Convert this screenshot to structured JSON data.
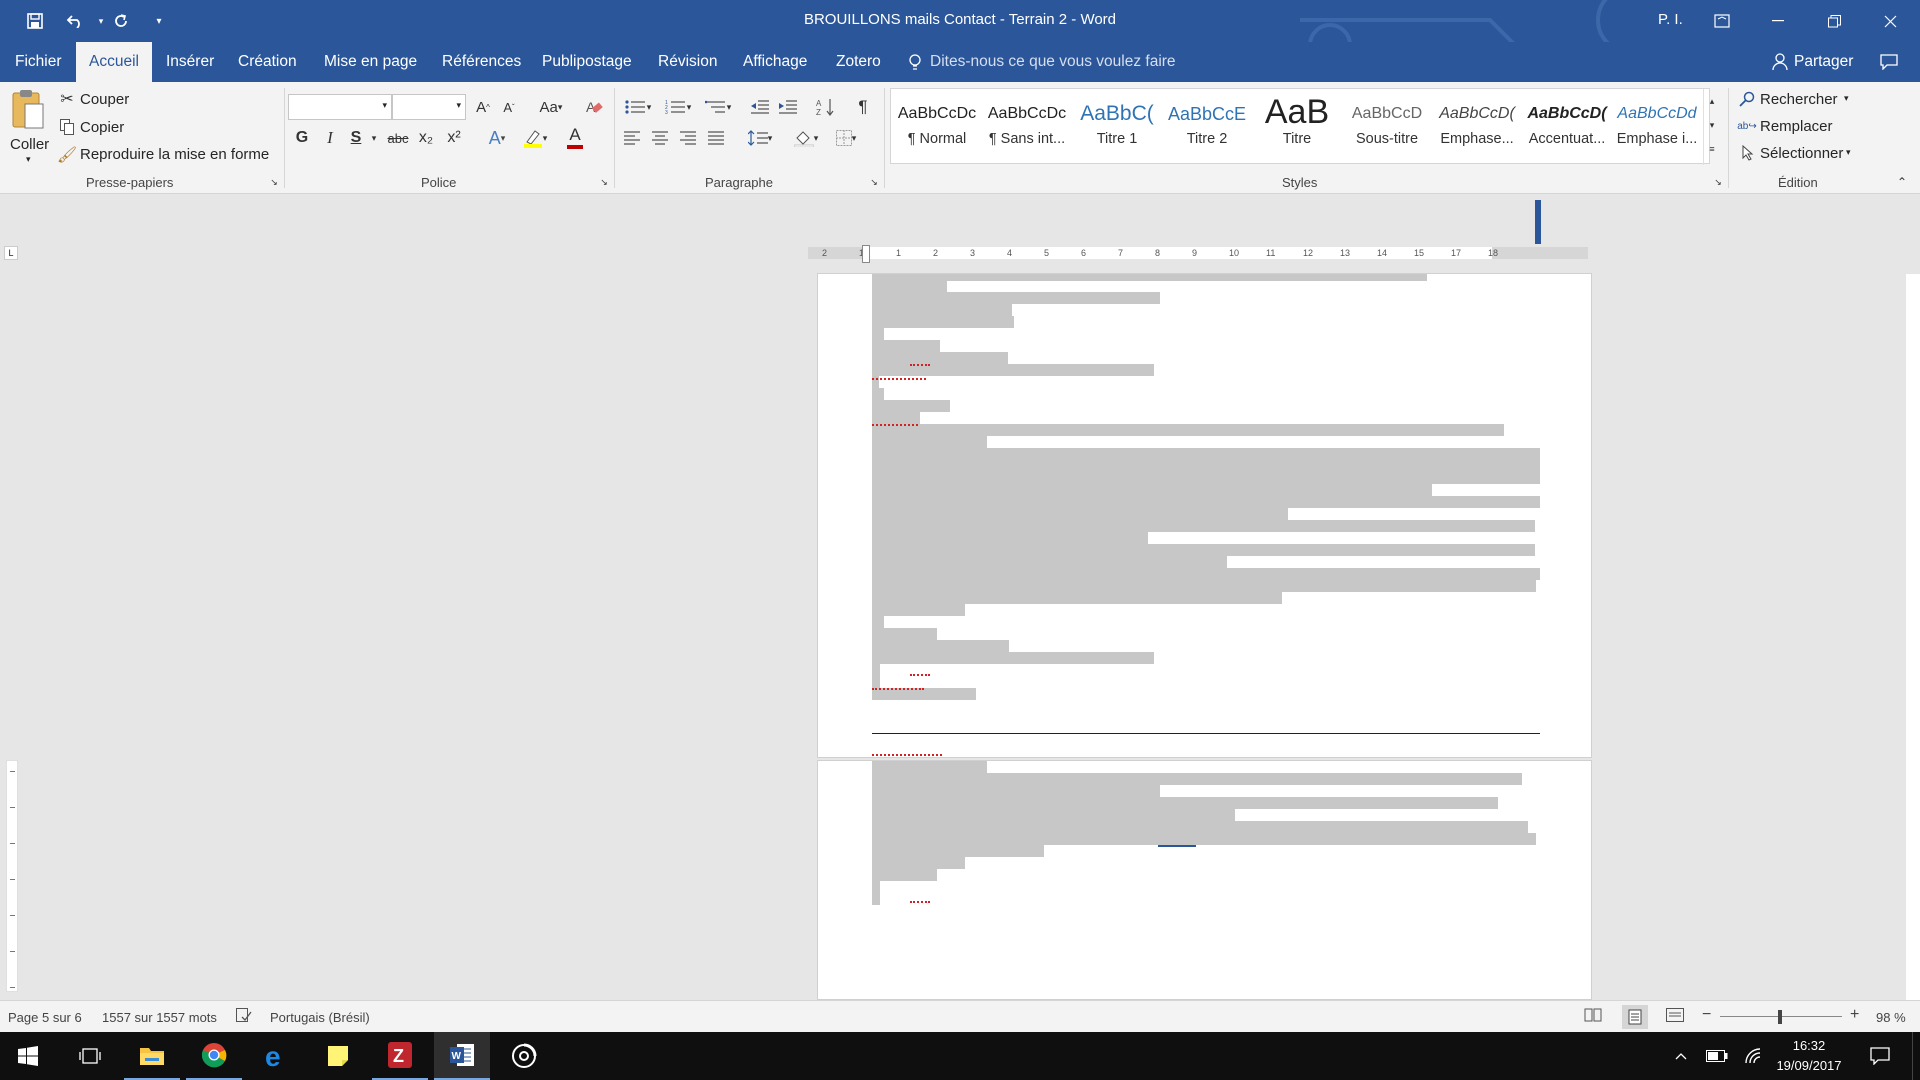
{
  "window": {
    "title": "BROUILLONS mails Contact - Terrain 2  -  Word",
    "user": "P. I.",
    "colors": {
      "brand": "#2b579a",
      "ribbon": "#f3f3f3",
      "page": "#ffffff",
      "highlight": "#c7c7c7"
    }
  },
  "quick_access": {
    "icons": [
      "save-icon",
      "undo-icon",
      "redo-icon",
      "customize-icon"
    ]
  },
  "tabs": [
    {
      "label": "Fichier"
    },
    {
      "label": "Accueil",
      "active": true
    },
    {
      "label": "Insérer"
    },
    {
      "label": "Création"
    },
    {
      "label": "Mise en page"
    },
    {
      "label": "Références"
    },
    {
      "label": "Publipostage"
    },
    {
      "label": "Révision"
    },
    {
      "label": "Affichage"
    },
    {
      "label": "Zotero"
    }
  ],
  "tellme": "Dites-nous ce que vous voulez faire",
  "share": "Partager",
  "ribbon": {
    "clipboard": {
      "group_label": "Presse-papiers",
      "paste": "Coller",
      "cut": "Couper",
      "copy": "Copier",
      "format_painter": "Reproduire la mise en forme"
    },
    "font": {
      "group_label": "Police",
      "font_name": "",
      "font_size": "",
      "bold": "G",
      "italic": "I",
      "underline": "S",
      "strike": "abc",
      "subscript": "x₂",
      "superscript": "x²",
      "grow": "A",
      "shrink": "A",
      "case": "Aa",
      "font_color": "A"
    },
    "paragraph": {
      "group_label": "Paragraphe",
      "pilcrow": "¶"
    },
    "styles": {
      "group_label": "Styles",
      "items": [
        {
          "preview": "AaBbCcDc",
          "name": "¶ Normal"
        },
        {
          "preview": "AaBbCcDc",
          "name": "¶ Sans int..."
        },
        {
          "preview": "AaBbC(",
          "name": "Titre 1"
        },
        {
          "preview": "AaBbCcE",
          "name": "Titre 2"
        },
        {
          "preview": "AaB",
          "name": "Titre"
        },
        {
          "preview": "AaBbCcD",
          "name": "Sous-titre"
        },
        {
          "preview": "AaBbCcD(",
          "name": "Emphase..."
        },
        {
          "preview": "AaBbCcD(",
          "name": "Accentuat..."
        },
        {
          "preview": "AaBbCcDd",
          "name": "Emphase i..."
        }
      ]
    },
    "editing": {
      "group_label": "Édition",
      "find": "Rechercher",
      "replace": "Remplacer",
      "select": "Sélectionner"
    }
  },
  "ruler": {
    "ticks": [
      "2",
      "1",
      "1",
      "2",
      "3",
      "4",
      "5",
      "6",
      "7",
      "8",
      "9",
      "10",
      "11",
      "12",
      "13",
      "14",
      "15",
      "17",
      "18"
    ]
  },
  "status": {
    "page": "Page 5 sur 6",
    "words": "1557 sur 1557 mots",
    "language": "Portugais (Brésil)",
    "zoom": "98 %",
    "zoom_value": 0.98
  },
  "taskbar": {
    "time": "16:32",
    "date": "19/09/2017",
    "apps": [
      "windows-start-icon",
      "task-view-icon",
      "file-explorer-icon",
      "chrome-icon",
      "edge-icon",
      "sticky-notes-icon",
      "zotero-icon",
      "word-icon",
      "groove-icon"
    ]
  }
}
